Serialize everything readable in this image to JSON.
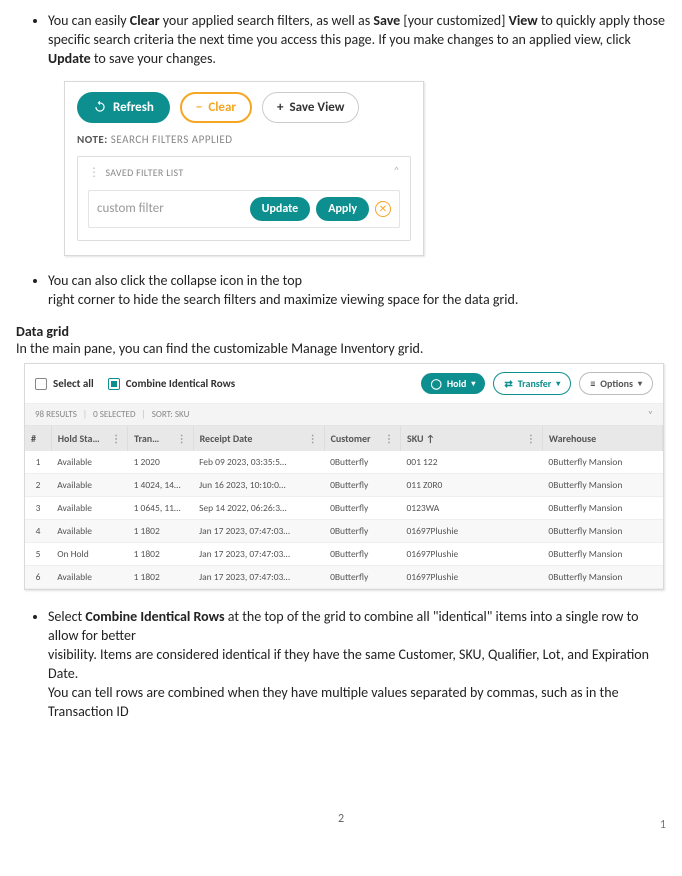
{
  "bullets": {
    "b1_pre": "You can easily ",
    "b1_w1": "Clear",
    "b1_mid1": " your applied search filters, as well as ",
    "b1_w2": "Save",
    "b1_mid2": " [your customized] ",
    "b1_w3": "View",
    "b1_mid3": " to quickly apply those specific search criteria the next time you access this page. If you make changes to an applied view, click ",
    "b1_w4": "Update",
    "b1_post": " to save your changes.",
    "b2_l1": "You can also click the collapse icon in the top",
    "b2_l2": "right corner to hide the search filters and maximize viewing space for the data grid.",
    "b3_pre": "Select ",
    "b3_bold": "Combine Identical Rows",
    "b3_mid": " at the top of the grid to combine all \"identical\" items into a single row to allow for better",
    "b3_l2": "visibility. Items are considered identical if they have the same Customer, SKU, Qualifier, Lot, and Expiration Date.",
    "b3_l3": "You can tell rows are combined when they have multiple values separated by commas, such as in the Transaction ID"
  },
  "panel": {
    "refresh": "Refresh",
    "clear": "Clear",
    "save_view": "Save View",
    "note_label": "NOTE:",
    "note_text": "SEARCH FILTERS APPLIED",
    "saved_header": "SAVED FILTER LIST",
    "filter_name": "custom filter",
    "update": "Update",
    "apply": "Apply"
  },
  "section": {
    "heading": "Data grid",
    "sub": "In the main pane, you can find the customizable Manage Inventory grid."
  },
  "grid": {
    "select_all": "Select all",
    "combine": "Combine Identical Rows",
    "hold": "Hold",
    "transfer": "Transfer",
    "options": "Options",
    "meta_results": "98  RESULTS",
    "meta_selected": "0  SELECTED",
    "meta_sort_label": "SORT:",
    "meta_sort_value": "SKU",
    "cols": {
      "idx": "#",
      "hold": "Hold Sta…",
      "tran": "Tran…",
      "receipt": "Receipt  Date",
      "customer": "Customer",
      "sku_label": "SKU",
      "sku_arrow": "↑",
      "warehouse": "Warehouse"
    },
    "rows": [
      {
        "n": "1",
        "hold": "Available",
        "tran": "1 2020",
        "date": "Feb 09 2023, 03:35:5…",
        "cust": "0Butterfly",
        "sku": "001 122",
        "wh": "0Butterfly Mansion"
      },
      {
        "n": "2",
        "hold": "Available",
        "tran": "1 4024, 14…",
        "date": "Jun 16 2023, 10:10:0…",
        "cust": "0Butterfly",
        "sku": "011 Z0R0",
        "wh": "0Butterfly Mansion"
      },
      {
        "n": "3",
        "hold": "Available",
        "tran": "1 0645, 11…",
        "date": "Sep 14 2022, 06:26:3…",
        "cust": "0Butterfly",
        "sku": "0123WA",
        "wh": "0Butterfly Mansion"
      },
      {
        "n": "4",
        "hold": "Available",
        "tran": "1 1802",
        "date": "Jan 17 2023, 07:47:03…",
        "cust": "0Butterfly",
        "sku": "01697Plushie",
        "wh": "0Butterfly Mansion"
      },
      {
        "n": "5",
        "hold": "On Hold",
        "tran": "1 1802",
        "date": "Jan 17 2023, 07:47:03…",
        "cust": "0Butterfly",
        "sku": "01697Plushie",
        "wh": "0Butterfly Mansion"
      },
      {
        "n": "6",
        "hold": "Available",
        "tran": "1 1802",
        "date": "Jan 17 2023, 07:47:03…",
        "cust": "0Butterfly",
        "sku": "01697Plushie",
        "wh": "0Butterfly Mansion"
      }
    ]
  },
  "page": {
    "center": "2",
    "right": "1"
  }
}
